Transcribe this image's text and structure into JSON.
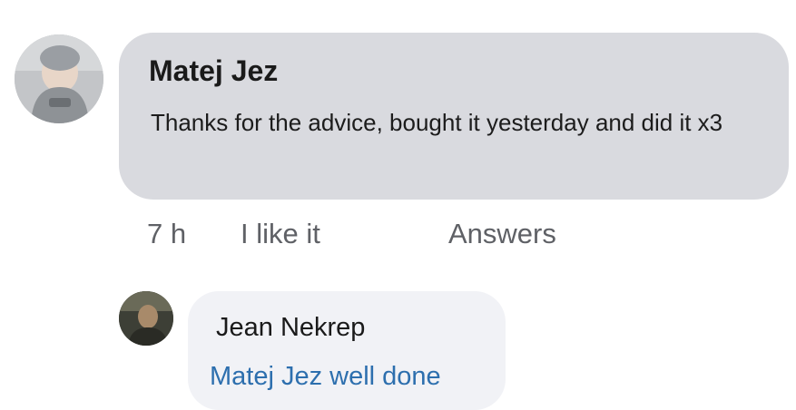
{
  "comment": {
    "author": "Matej Jez",
    "text": "Thanks for the advice, bought it yesterday and did it x3",
    "time": "7 h",
    "like_label": "I like it",
    "answers_label": "Answers"
  },
  "reply": {
    "author": "Jean Nekrep",
    "text": "Matej Jez well done"
  },
  "colors": {
    "comment_bubble": "#d9dadf",
    "reply_bubble": "#f1f2f6",
    "meta_text": "#5f6166",
    "mention_link": "#2d6fae"
  }
}
